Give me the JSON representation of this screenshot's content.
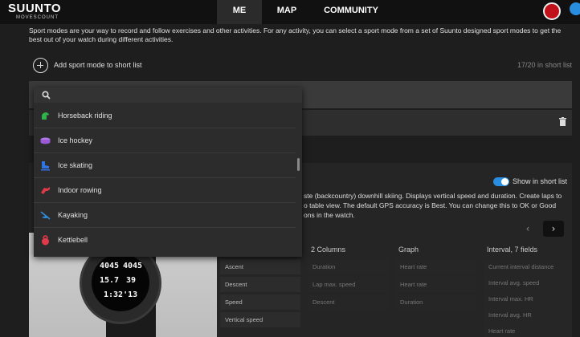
{
  "header": {
    "logo_main": "SUUNTO",
    "logo_sub": "MOVESCOUNT",
    "tabs": [
      {
        "label": "ME",
        "active": true
      },
      {
        "label": "MAP",
        "active": false
      },
      {
        "label": "COMMUNITY",
        "active": false
      }
    ]
  },
  "intro": "Sport modes are your way to record and follow exercises and other activities. For any activity, you can select a sport mode from a set of Suunto designed sport modes to get the best out of your watch during different activities.",
  "add_label": "Add sport mode to short list",
  "count": "17/20 in short list",
  "search": {
    "value": "",
    "placeholder": ""
  },
  "dropdown_items": [
    {
      "label": "Horseback riding",
      "icon": "horse-icon",
      "color": "#2fb24a"
    },
    {
      "label": "Ice hockey",
      "icon": "puck-icon",
      "color": "#9b59d6"
    },
    {
      "label": "Ice skating",
      "icon": "skate-icon",
      "color": "#2f74e0"
    },
    {
      "label": "Indoor rowing",
      "icon": "rowing-icon",
      "color": "#e03a4a"
    },
    {
      "label": "Kayaking",
      "icon": "kayak-icon",
      "color": "#2f8ee0"
    },
    {
      "label": "Kettlebell",
      "icon": "kettlebell-icon",
      "color": "#e03a4a"
    }
  ],
  "show_in_short_list": "Show in short list",
  "description": {
    "line1": "ste (backcountry) downhill skiing. Displays vertical speed and duration. Create laps to",
    "line2": "o table view. The default GPS accuracy is Best. You can change this to OK or Good",
    "line3": "ons in the watch."
  },
  "watch": {
    "top_left": "4045",
    "top_right": "4045",
    "mid_left": "15.7",
    "mid_right": "39",
    "bottom": "1:32'13"
  },
  "columns": [
    {
      "header": "",
      "cells": [
        "Ascent",
        "Descent",
        "Speed",
        "Vertical speed"
      ]
    },
    {
      "header": "2 Columns",
      "cells": [
        "Duration",
        "Lap max. speed",
        "Descent"
      ]
    },
    {
      "header": "Graph",
      "cells": [
        "Heart rate",
        "Heart rate",
        "Duration"
      ]
    },
    {
      "header": "Interval, 7 fields",
      "cells": [
        "Current interval distance",
        "Interval avg. speed",
        "Interval max. HR",
        "Interval avg. HR",
        "Heart rate"
      ]
    }
  ],
  "colors": {
    "accent": "#2a8ee0",
    "brand_red": "#c1121c"
  }
}
